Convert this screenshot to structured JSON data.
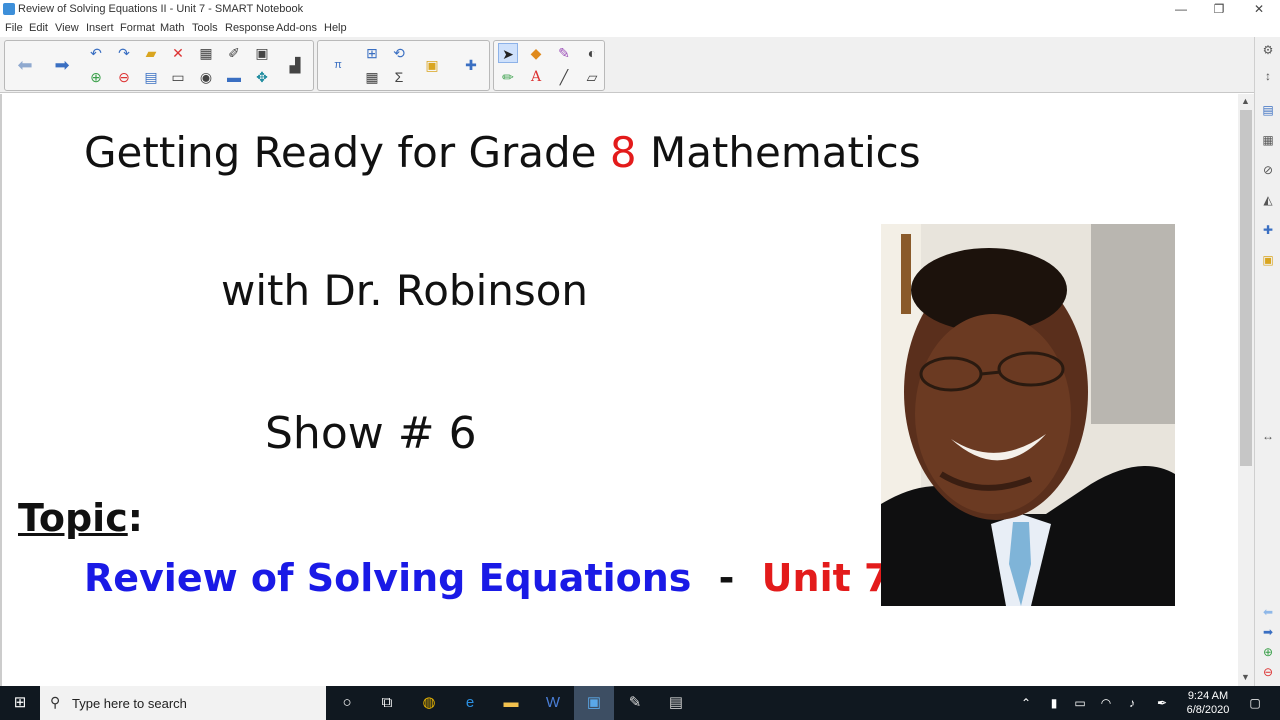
{
  "window": {
    "title": "Review of Solving Equations II - Unit 7 - SMART Notebook",
    "minimize": "—",
    "restore": "❐",
    "close": "✕"
  },
  "menu": [
    "File",
    "Edit",
    "View",
    "Insert",
    "Format",
    "Math",
    "Tools",
    "Response",
    "Add-ons",
    "Help"
  ],
  "slide": {
    "title_pre": "Getting Ready for Grade ",
    "title_num": "8",
    "title_post": " Mathematics",
    "subtitle": "with Dr. Robinson",
    "show": "Show # 6",
    "topic_label": "Topic",
    "topic_colon": ":",
    "topic_main": "Review of Solving Equations",
    "topic_dash": "-",
    "topic_unit": "Unit 7"
  },
  "colors": {
    "red": "#e31b1b",
    "blue": "#1a1ae6",
    "accent": "#3a6fc2"
  },
  "taskbar": {
    "search_placeholder": "Type here to search",
    "time": "9:24 AM",
    "date": "6/8/2020"
  }
}
